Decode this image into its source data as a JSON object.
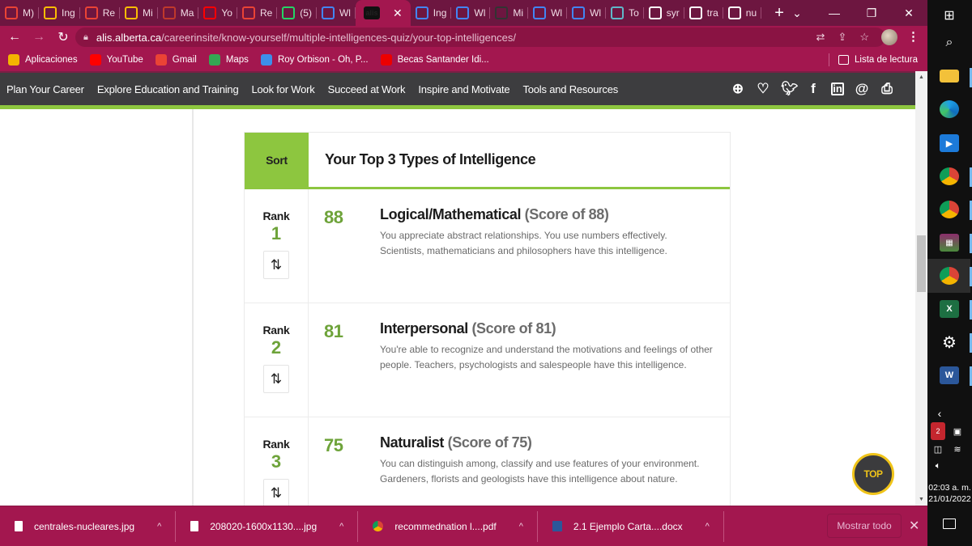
{
  "browser": {
    "tabs": [
      {
        "label": "M)",
        "icon": "gmail-icon",
        "color": "#ea4335"
      },
      {
        "label": "Ing",
        "icon": "google-drive-icon",
        "color": "#fbbc04"
      },
      {
        "label": "Re",
        "icon": "gmail-icon",
        "color": "#ea4335"
      },
      {
        "label": "Mi",
        "icon": "google-drive-icon",
        "color": "#fbbc04"
      },
      {
        "label": "Ma",
        "icon": "w-logo-icon",
        "color": "#c0392b"
      },
      {
        "label": "Yo",
        "icon": "youtube-icon",
        "color": "#ff0000"
      },
      {
        "label": "Re",
        "icon": "gmail-icon",
        "color": "#ea4335"
      },
      {
        "label": "(5)",
        "icon": "whatsapp-icon",
        "color": "#25d366"
      },
      {
        "label": "Wl",
        "icon": "google-classroom-icon",
        "color": "#4285f4"
      },
      {
        "label": "",
        "icon": "alis-icon",
        "color": "#222222",
        "active": true
      },
      {
        "label": "Ing",
        "icon": "google-classroom-icon",
        "color": "#4285f4"
      },
      {
        "label": "Wl",
        "icon": "google-classroom-icon",
        "color": "#4285f4"
      },
      {
        "label": "Mi",
        "icon": "j-avatar-icon",
        "color": "#333333"
      },
      {
        "label": "Wl",
        "icon": "google-classroom-icon",
        "color": "#4285f4"
      },
      {
        "label": "Wl",
        "icon": "google-classroom-icon",
        "color": "#4285f4"
      },
      {
        "label": "To",
        "icon": "f-doc-icon",
        "color": "#5fb7c9"
      },
      {
        "label": "syr",
        "icon": "google-icon",
        "color": "#ffffff"
      },
      {
        "label": "tra",
        "icon": "google-icon",
        "color": "#ffffff"
      },
      {
        "label": "nu",
        "icon": "google-icon",
        "color": "#ffffff"
      }
    ],
    "active_tab_favicon_text": "alis",
    "url_host": "alis.alberta.ca",
    "url_path": "/careerinsite/know-yourself/multiple-intelligences-quiz/your-top-intelligences/",
    "bookmarks": [
      {
        "label": "Aplicaciones",
        "icon": "apps-grid-icon",
        "color": "#f4b400"
      },
      {
        "label": "YouTube",
        "icon": "youtube-icon",
        "color": "#ff0000"
      },
      {
        "label": "Gmail",
        "icon": "gmail-icon",
        "color": "#ea4335"
      },
      {
        "label": "Maps",
        "icon": "maps-pin-icon",
        "color": "#34a853"
      },
      {
        "label": "Roy Orbison - Oh, P...",
        "icon": "music-app-icon",
        "color": "#3d8eea"
      },
      {
        "label": "Becas Santander Idi...",
        "icon": "santander-icon",
        "color": "#ec0000"
      }
    ],
    "reading_list_label": "Lista de lectura"
  },
  "site": {
    "nav": [
      "Plan Your Career",
      "Explore Education and Training",
      "Look for Work",
      "Succeed at Work",
      "Inspire and Motivate",
      "Tools and Resources"
    ],
    "accent_color": "#8dc63f"
  },
  "results": {
    "sort_label": "Sort",
    "title": "Your Top 3 Types of Intelligence",
    "rank_label": "Rank",
    "items": [
      {
        "rank": "1",
        "score": "88",
        "name": "Logical/Mathematical",
        "score_text": "(Score of 88)",
        "description": "You appreciate abstract relationships. You use numbers effectively. Scientists, mathematicians and philosophers have this intelligence."
      },
      {
        "rank": "2",
        "score": "81",
        "name": "Interpersonal",
        "score_text": "(Score of 81)",
        "description": "You're able to recognize and understand the motivations and feelings of other people. Teachers, psychologists and salespeople have this intelligence."
      },
      {
        "rank": "3",
        "score": "75",
        "name": "Naturalist",
        "score_text": "(Score of 75)",
        "description": "You can distinguish among, classify and use features of your environment. Gardeners, florists and geologists have this intelligence about nature."
      }
    ],
    "top_button_label": "TOP"
  },
  "downloads": {
    "items": [
      {
        "name": "centrales-nucleares.jpg",
        "type": "image"
      },
      {
        "name": "208020-1600x1130....jpg",
        "type": "image"
      },
      {
        "name": "recommednation l....pdf",
        "type": "chrome"
      },
      {
        "name": "2.1 Ejemplo Carta....docx",
        "type": "word"
      }
    ],
    "show_all_label": "Mostrar todo"
  },
  "taskbar": {
    "time": "02:03 a. m.",
    "date": "21/01/2022",
    "tray_badge": "2"
  }
}
